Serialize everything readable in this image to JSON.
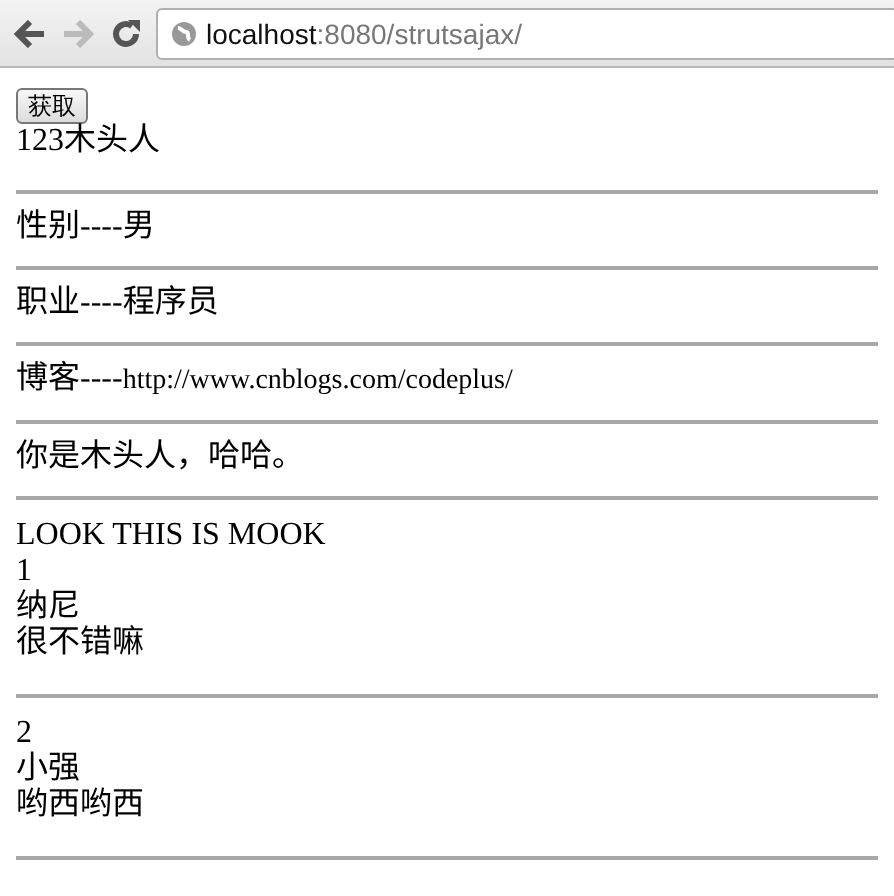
{
  "browser": {
    "url_host": "localhost",
    "url_path": ":8080/strutsajax/",
    "forward_disabled": true
  },
  "page": {
    "button": "获取",
    "heading": "123木头人",
    "fields": [
      {
        "label": "性别----",
        "value": "男",
        "kind": "text"
      },
      {
        "label": "职业----",
        "value": "程序员",
        "kind": "text"
      },
      {
        "label": "博客----",
        "value": "http://www.cnblogs.com/codeplus/",
        "kind": "url"
      }
    ],
    "message": "你是木头人，哈哈。",
    "title": "LOOK THIS IS MOOK",
    "people": [
      {
        "id": "1",
        "name": "纳尼",
        "comment": "很不错嘛"
      },
      {
        "id": "2",
        "name": "小强",
        "comment": "哟西哟西"
      }
    ]
  }
}
